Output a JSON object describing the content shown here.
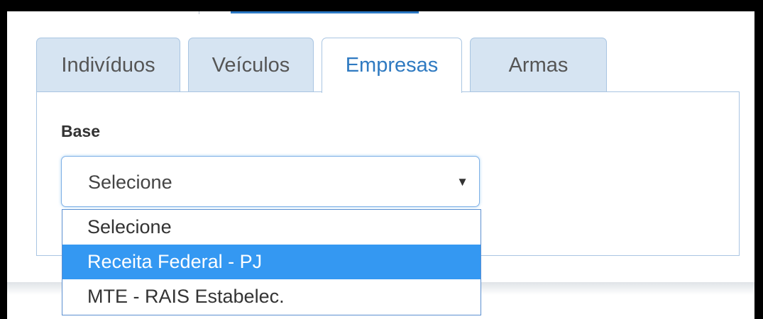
{
  "tabs": [
    {
      "label": "Indivíduos",
      "active": false
    },
    {
      "label": "Veículos",
      "active": false
    },
    {
      "label": "Empresas",
      "active": true
    },
    {
      "label": "Armas",
      "active": false
    }
  ],
  "form": {
    "base_label": "Base",
    "base_select_value": "Selecione",
    "base_options": [
      {
        "label": "Selecione",
        "highlighted": false
      },
      {
        "label": "Receita Federal - PJ",
        "highlighted": true
      },
      {
        "label": "MTE - RAIS Estabelec.",
        "highlighted": false
      }
    ]
  },
  "icons": {
    "select_arrow": "caret-down-icon"
  },
  "colors": {
    "accent": "#2f7ac1",
    "tab_inactive_bg": "#d6e4f2",
    "option_highlight": "#3498f2"
  }
}
